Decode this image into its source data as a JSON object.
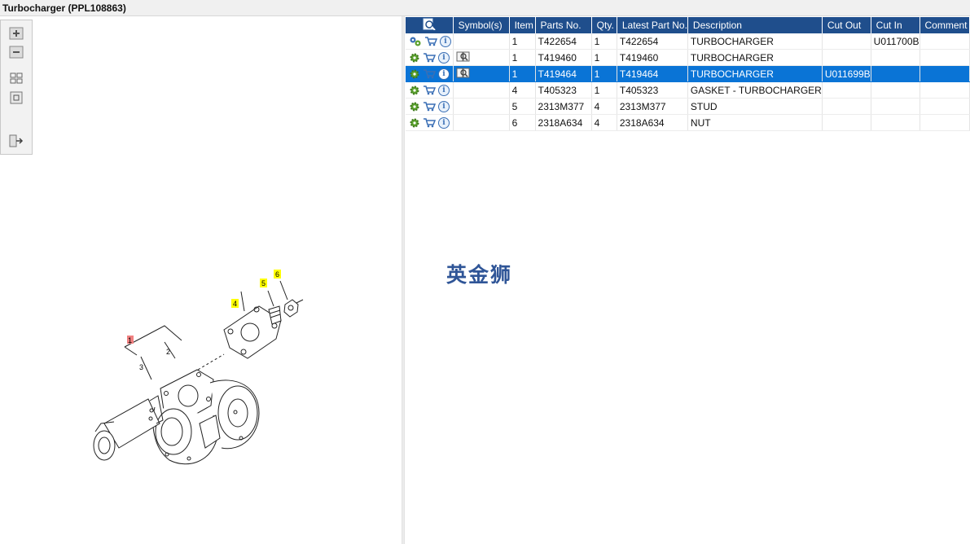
{
  "window": {
    "title": "Turbocharger (PPL108863)"
  },
  "toolbox": {
    "icons": [
      "zoom-in-icon",
      "zoom-out-icon",
      "fit-all-icon",
      "fit-window-icon",
      "export-icon"
    ]
  },
  "diagram": {
    "callouts": [
      "1",
      "2",
      "3",
      "4",
      "5",
      "6"
    ],
    "highlight_colors": {
      "selected": "#f08080",
      "normal": "#ffff00"
    }
  },
  "table": {
    "headers": [
      "",
      "Symbol(s)",
      "Item",
      "Parts No.",
      "Qty.",
      "Latest Part No.",
      "Description",
      "Cut Out",
      "Cut In",
      "Comment"
    ],
    "rows": [
      {
        "item": "1",
        "part_no": "T422654",
        "qty": "1",
        "latest": "T422654",
        "description": "TURBOCHARGER",
        "cut_out": "",
        "cut_in": "U011700B",
        "comment": "",
        "symbol": ""
      },
      {
        "item": "1",
        "part_no": "T419460",
        "qty": "1",
        "latest": "T419460",
        "description": "TURBOCHARGER",
        "cut_out": "",
        "cut_in": "",
        "comment": "",
        "symbol": "book-icon"
      },
      {
        "item": "1",
        "part_no": "T419464",
        "qty": "1",
        "latest": "T419464",
        "description": "TURBOCHARGER",
        "cut_out": "U011699B",
        "cut_in": "",
        "comment": "",
        "symbol": "book-icon"
      },
      {
        "item": "4",
        "part_no": "T405323",
        "qty": "1",
        "latest": "T405323",
        "description": "GASKET - TURBOCHARGER",
        "cut_out": "",
        "cut_in": "",
        "comment": "",
        "symbol": ""
      },
      {
        "item": "5",
        "part_no": "2313M377",
        "qty": "4",
        "latest": "2313M377",
        "description": "STUD",
        "cut_out": "",
        "cut_in": "",
        "comment": "",
        "symbol": ""
      },
      {
        "item": "6",
        "part_no": "2318A634",
        "qty": "4",
        "latest": "2318A634",
        "description": "NUT",
        "cut_out": "",
        "cut_in": "",
        "comment": "",
        "symbol": ""
      }
    ],
    "selected_row": 2
  },
  "watermark": "英金狮",
  "colors": {
    "header_bg": "#1f4e8c",
    "selected_bg": "#0a74d6",
    "gear_green": "#5aa02c",
    "cart_blue": "#3a6fb5"
  }
}
